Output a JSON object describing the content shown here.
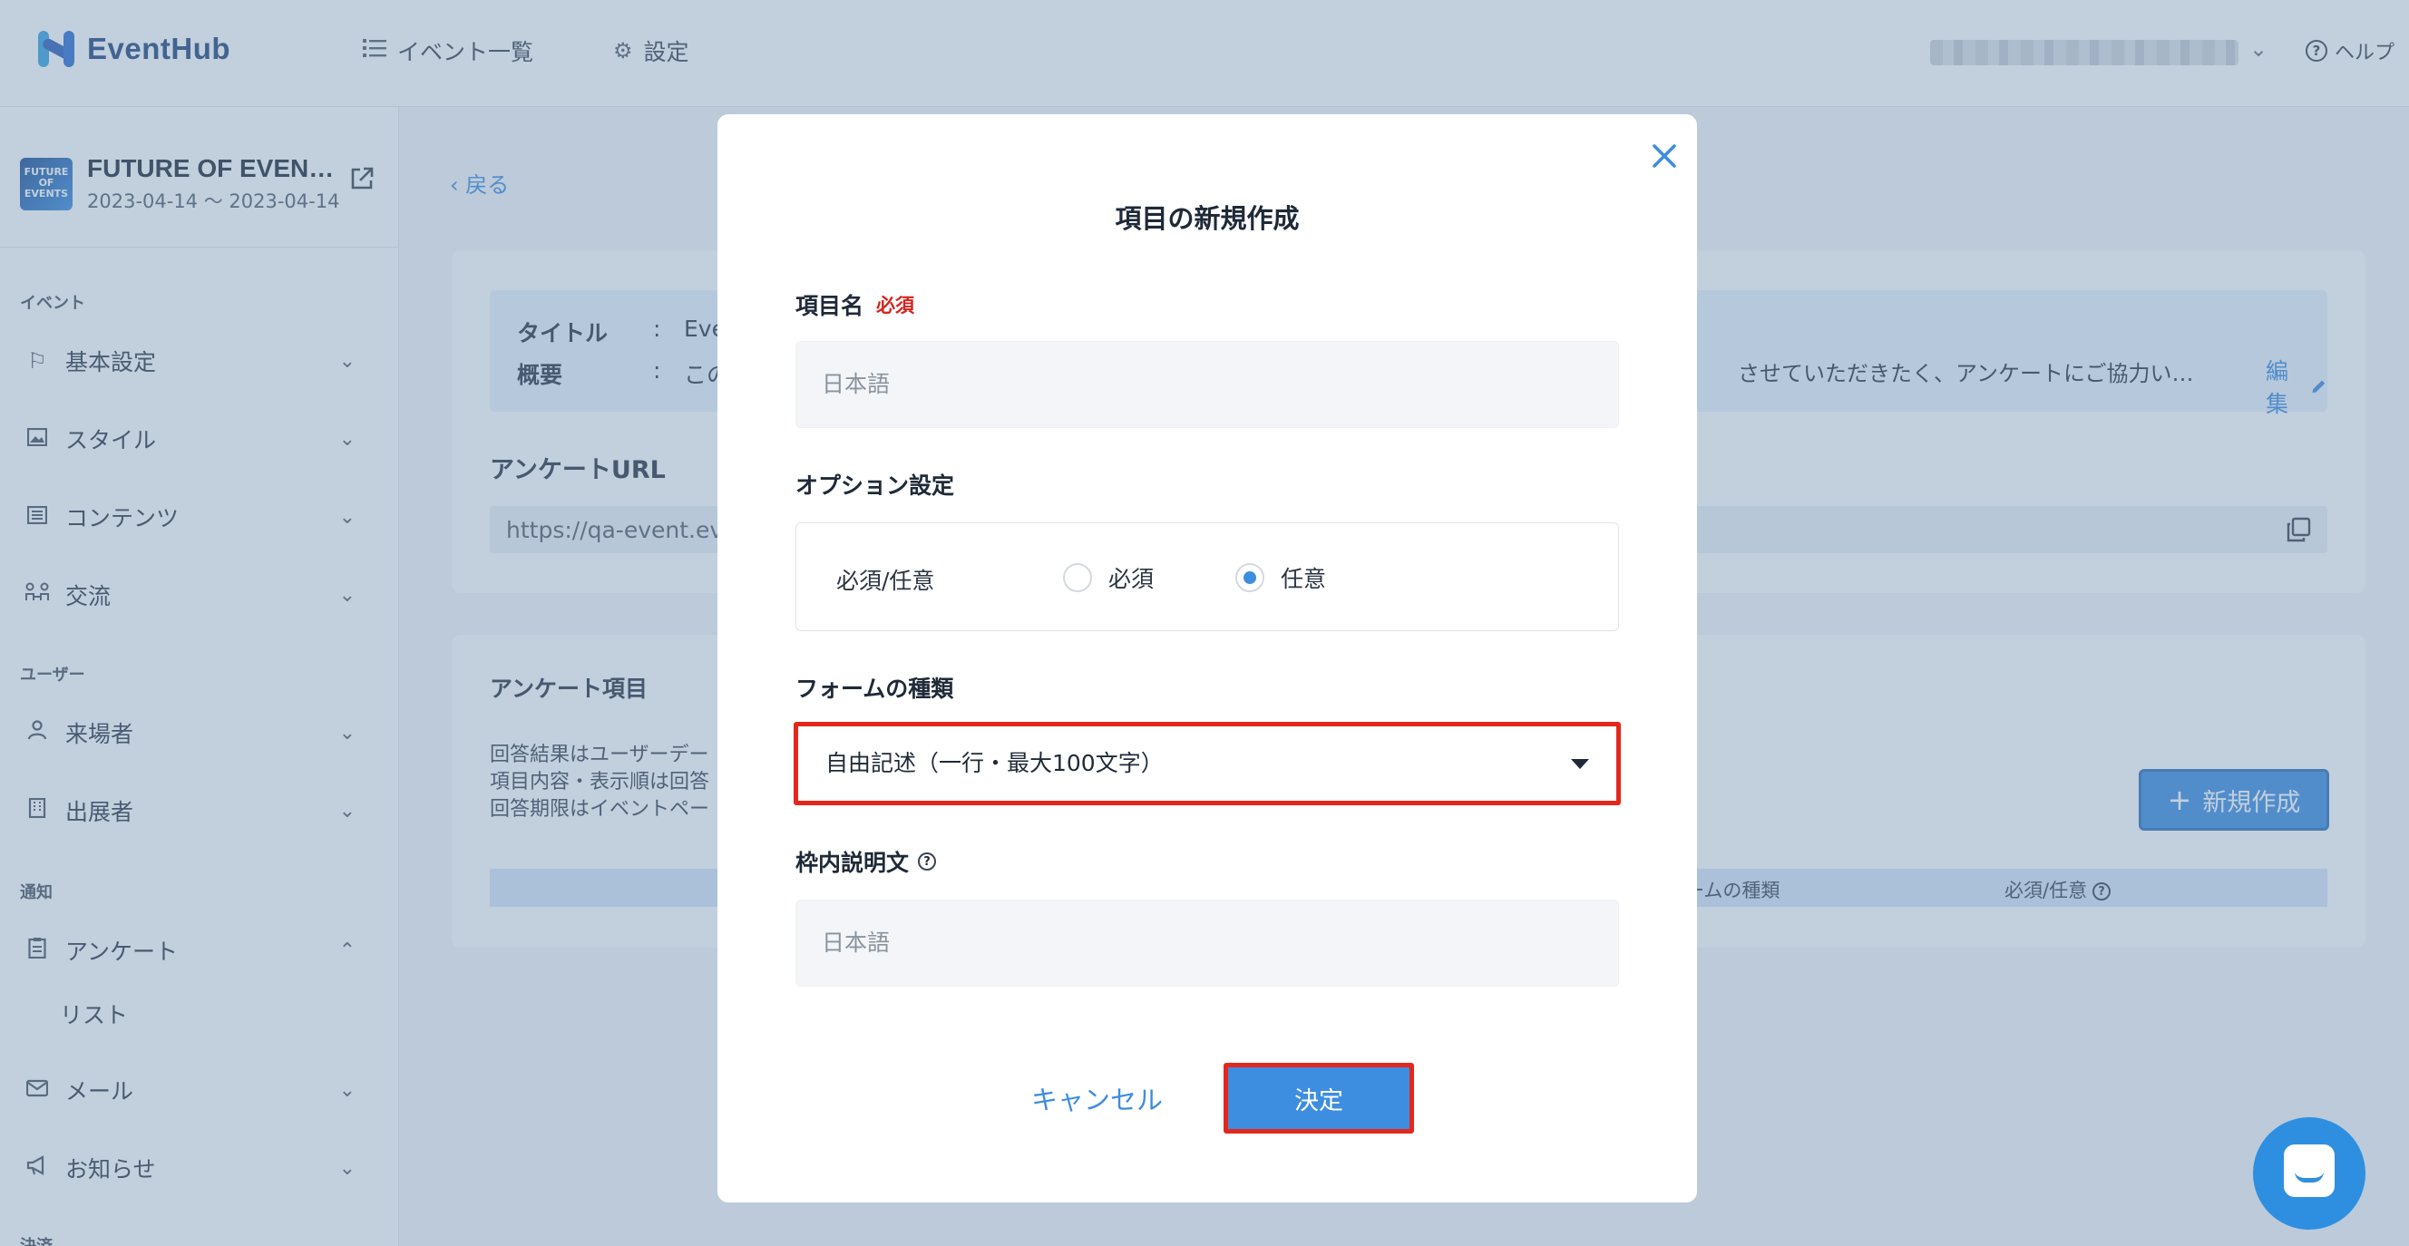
{
  "header": {
    "logo_text": "EventHub",
    "nav": [
      {
        "label": "イベント一覧",
        "icon": "list-icon"
      },
      {
        "label": "設定",
        "icon": "gear-icon"
      }
    ],
    "help_label": "ヘルプ"
  },
  "sidebar": {
    "event": {
      "thumb_text": "FUTURE OF EVENTS",
      "name": "FUTURE OF EVEN…",
      "dates": "2023-04-14 〜 2023-04-14"
    },
    "sections": [
      {
        "label": "イベント"
      },
      {
        "label": "ユーザー"
      },
      {
        "label": "通知"
      },
      {
        "label": "決済"
      }
    ],
    "items": [
      {
        "label": "基本設定",
        "icon": "flag-icon"
      },
      {
        "label": "スタイル",
        "icon": "image-icon"
      },
      {
        "label": "コンテンツ",
        "icon": "list-box-icon"
      },
      {
        "label": "交流",
        "icon": "network-icon"
      },
      {
        "label": "来場者",
        "icon": "person-icon"
      },
      {
        "label": "出展者",
        "icon": "building-icon"
      },
      {
        "label": "アンケート",
        "icon": "clipboard-icon"
      },
      {
        "label": "メール",
        "icon": "mail-icon"
      },
      {
        "label": "お知らせ",
        "icon": "megaphone-icon"
      }
    ],
    "subitems": [
      {
        "label": "リスト"
      }
    ]
  },
  "main": {
    "back_label": "戻る",
    "info": {
      "title_label": "タイトル",
      "title_value": "Eve",
      "summary_label": "概要",
      "summary_value": "この",
      "summary_tail": "させていただきたく、アンケートにご協力い…",
      "separator": ":",
      "edit_label": "編集"
    },
    "url_label": "アンケートURL",
    "url_value": "https://qa-event.ev",
    "items_title": "アンケート項目",
    "items_lines": [
      "回答結果はユーザーデー",
      "項目内容・表示順は回答",
      "回答期限はイベントペー"
    ],
    "new_button": "新規作成",
    "table_headers": [
      "ームの種類",
      "必須/任意"
    ]
  },
  "modal": {
    "title": "項目の新規作成",
    "item_name_label": "項目名",
    "required_badge": "必須",
    "item_name_placeholder": "日本語",
    "option_label": "オプション設定",
    "option_row_label": "必須/任意",
    "radio_options": [
      {
        "label": "必須",
        "selected": false
      },
      {
        "label": "任意",
        "selected": true
      }
    ],
    "form_type_label": "フォームの種類",
    "form_type_value": "自由記述（一行・最大100文字）",
    "inner_desc_label": "枠内説明文",
    "inner_desc_placeholder": "日本語",
    "cancel_label": "キャンセル",
    "confirm_label": "決定"
  },
  "colors": {
    "accent": "#3d8de0",
    "highlight": "#e3271c",
    "required": "#d2261d"
  }
}
